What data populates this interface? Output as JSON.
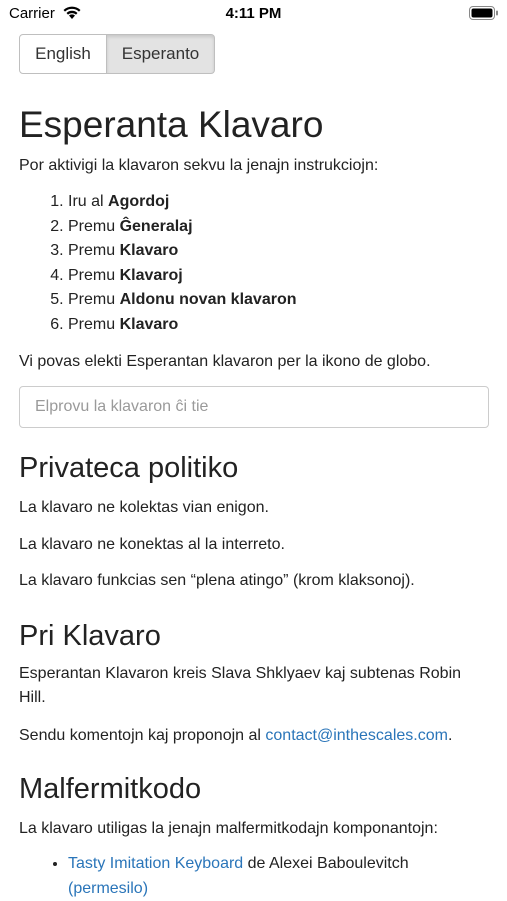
{
  "status": {
    "carrier": "Carrier",
    "time": "4:11 PM"
  },
  "language": {
    "english": "English",
    "esperanto": "Esperanto"
  },
  "title": "Esperanta Klavaro",
  "intro": "Por aktivigi la klavaron sekvu la jenajn instrukciojn:",
  "steps": [
    {
      "prefix": "Iru al ",
      "bold": "Agordoj"
    },
    {
      "prefix": "Premu ",
      "bold": "Ĝeneralaj"
    },
    {
      "prefix": "Premu ",
      "bold": "Klavaro"
    },
    {
      "prefix": "Premu ",
      "bold": "Klavaroj"
    },
    {
      "prefix": "Premu ",
      "bold": "Aldonu novan klavaron"
    },
    {
      "prefix": "Premu ",
      "bold": "Klavaro"
    }
  ],
  "globe_note": "Vi povas elekti Esperantan klavaron per la ikono de globo.",
  "try_placeholder": "Elprovu la klavaron ĉi tie",
  "privacy": {
    "heading": "Privateca politiko",
    "lines": [
      "La klavaro ne kolektas vian enigon.",
      "La klavaro ne konektas al la interreto.",
      "La klavaro funkcias sen “plena atingo” (krom klaksonoj)."
    ]
  },
  "about": {
    "heading": "Pri Klavaro",
    "credits": "Esperantan Klavaron kreis Slava Shklyaev kaj subtenas Robin Hill.",
    "contact_prefix": "Sendu komentojn kaj proponojn al ",
    "contact_email": "contact@inthescales.com",
    "contact_suffix": "."
  },
  "opensource": {
    "heading": "Malfermitkodo",
    "intro": "La klavaro utiligas la jenajn malfermitkodajn komponantojn:",
    "item_link": "Tasty Imitation Keyboard",
    "item_author": " de Alexei Baboulevitch",
    "item_license": "(permesilo)"
  },
  "colors": {
    "link": "#2a75b9",
    "selected_segment": "#e3e3e3"
  }
}
